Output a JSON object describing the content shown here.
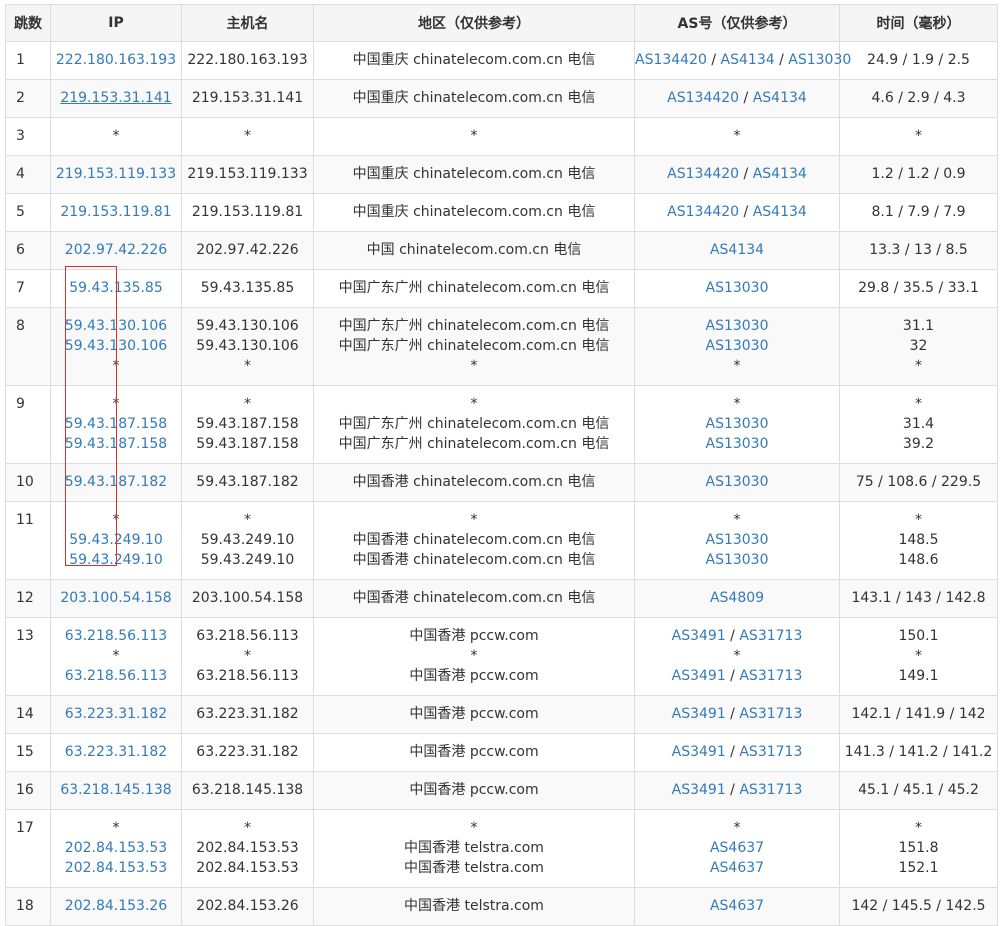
{
  "headers": [
    "跳数",
    "IP",
    "主机名",
    "地区（仅供参考）",
    "AS号（仅供参考）",
    "时间（毫秒）"
  ],
  "rows": [
    {
      "hop": "1",
      "lines": [
        {
          "ip": "222.180.163.193",
          "host": "222.180.163.193",
          "region": "中国重庆 chinatelecom.com.cn 电信",
          "as": [
            "AS134420",
            "AS4134",
            "AS13030"
          ],
          "time": "24.9 / 1.9 / 2.5"
        }
      ]
    },
    {
      "hop": "2",
      "lines": [
        {
          "ip": "219.153.31.141",
          "underline": true,
          "host": "219.153.31.141",
          "region": "中国重庆 chinatelecom.com.cn 电信",
          "as": [
            "AS134420",
            "AS4134"
          ],
          "time": "4.6 / 2.9 / 4.3"
        }
      ]
    },
    {
      "hop": "3",
      "lines": [
        {
          "ip": "*",
          "host": "*",
          "region": "*",
          "as": [],
          "as_text": "*",
          "time": "*"
        }
      ]
    },
    {
      "hop": "4",
      "lines": [
        {
          "ip": "219.153.119.133",
          "host": "219.153.119.133",
          "region": "中国重庆 chinatelecom.com.cn 电信",
          "as": [
            "AS134420",
            "AS4134"
          ],
          "time": "1.2 / 1.2 / 0.9"
        }
      ]
    },
    {
      "hop": "5",
      "lines": [
        {
          "ip": "219.153.119.81",
          "host": "219.153.119.81",
          "region": "中国重庆 chinatelecom.com.cn 电信",
          "as": [
            "AS134420",
            "AS4134"
          ],
          "time": "8.1 / 7.9 / 7.9"
        }
      ]
    },
    {
      "hop": "6",
      "lines": [
        {
          "ip": "202.97.42.226",
          "host": "202.97.42.226",
          "region": "中国 chinatelecom.com.cn 电信",
          "as": [
            "AS4134"
          ],
          "time": "13.3 / 13 / 8.5"
        }
      ]
    },
    {
      "hop": "7",
      "lines": [
        {
          "ip": "59.43.135.85",
          "host": "59.43.135.85",
          "region": "中国广东广州 chinatelecom.com.cn 电信",
          "as": [
            "AS13030"
          ],
          "time": "29.8 / 35.5 / 33.1"
        }
      ]
    },
    {
      "hop": "8",
      "lines": [
        {
          "ip": "59.43.130.106",
          "host": "59.43.130.106",
          "region": "中国广东广州 chinatelecom.com.cn 电信",
          "as": [
            "AS13030"
          ],
          "time": "31.1"
        },
        {
          "ip": "59.43.130.106",
          "host": "59.43.130.106",
          "region": "中国广东广州 chinatelecom.com.cn 电信",
          "as": [
            "AS13030"
          ],
          "time": "32"
        },
        {
          "ip": "*",
          "host": "*",
          "region": "*",
          "as": [],
          "as_text": "*",
          "time": "*"
        }
      ]
    },
    {
      "hop": "9",
      "lines": [
        {
          "ip": "*",
          "host": "*",
          "region": "*",
          "as": [],
          "as_text": "*",
          "time": "*"
        },
        {
          "ip": "59.43.187.158",
          "host": "59.43.187.158",
          "region": "中国广东广州 chinatelecom.com.cn 电信",
          "as": [
            "AS13030"
          ],
          "time": "31.4"
        },
        {
          "ip": "59.43.187.158",
          "host": "59.43.187.158",
          "region": "中国广东广州 chinatelecom.com.cn 电信",
          "as": [
            "AS13030"
          ],
          "time": "39.2"
        }
      ]
    },
    {
      "hop": "10",
      "lines": [
        {
          "ip": "59.43.187.182",
          "host": "59.43.187.182",
          "region": "中国香港 chinatelecom.com.cn 电信",
          "as": [
            "AS13030"
          ],
          "time": "75 / 108.6 / 229.5"
        }
      ]
    },
    {
      "hop": "11",
      "lines": [
        {
          "ip": "*",
          "host": "*",
          "region": "*",
          "as": [],
          "as_text": "*",
          "time": "*"
        },
        {
          "ip": "59.43.249.10",
          "host": "59.43.249.10",
          "region": "中国香港 chinatelecom.com.cn 电信",
          "as": [
            "AS13030"
          ],
          "time": "148.5"
        },
        {
          "ip": "59.43.249.10",
          "host": "59.43.249.10",
          "region": "中国香港 chinatelecom.com.cn 电信",
          "as": [
            "AS13030"
          ],
          "time": "148.6"
        }
      ]
    },
    {
      "hop": "12",
      "lines": [
        {
          "ip": "203.100.54.158",
          "host": "203.100.54.158",
          "region": "中国香港 chinatelecom.com.cn 电信",
          "as": [
            "AS4809"
          ],
          "time": "143.1 / 143 / 142.8"
        }
      ]
    },
    {
      "hop": "13",
      "lines": [
        {
          "ip": "63.218.56.113",
          "host": "63.218.56.113",
          "region": "中国香港 pccw.com",
          "as": [
            "AS3491",
            "AS31713"
          ],
          "time": "150.1"
        },
        {
          "ip": "*",
          "host": "*",
          "region": "*",
          "as": [],
          "as_text": "*",
          "time": "*"
        },
        {
          "ip": "63.218.56.113",
          "host": "63.218.56.113",
          "region": "中国香港 pccw.com",
          "as": [
            "AS3491",
            "AS31713"
          ],
          "time": "149.1"
        }
      ]
    },
    {
      "hop": "14",
      "lines": [
        {
          "ip": "63.223.31.182",
          "host": "63.223.31.182",
          "region": "中国香港 pccw.com",
          "as": [
            "AS3491",
            "AS31713"
          ],
          "time": "142.1 / 141.9 / 142"
        }
      ]
    },
    {
      "hop": "15",
      "lines": [
        {
          "ip": "63.223.31.182",
          "host": "63.223.31.182",
          "region": "中国香港 pccw.com",
          "as": [
            "AS3491",
            "AS31713"
          ],
          "time": "141.3 / 141.2 / 141.2"
        }
      ]
    },
    {
      "hop": "16",
      "lines": [
        {
          "ip": "63.218.145.138",
          "host": "63.218.145.138",
          "region": "中国香港 pccw.com",
          "as": [
            "AS3491",
            "AS31713"
          ],
          "time": "45.1 / 45.1 / 45.2"
        }
      ]
    },
    {
      "hop": "17",
      "lines": [
        {
          "ip": "*",
          "host": "*",
          "region": "*",
          "as": [],
          "as_text": "*",
          "time": "*"
        },
        {
          "ip": "202.84.153.53",
          "host": "202.84.153.53",
          "region": "中国香港 telstra.com",
          "as": [
            "AS4637"
          ],
          "time": "151.8"
        },
        {
          "ip": "202.84.153.53",
          "host": "202.84.153.53",
          "region": "中国香港 telstra.com",
          "as": [
            "AS4637"
          ],
          "time": "152.1"
        }
      ]
    },
    {
      "hop": "18",
      "lines": [
        {
          "ip": "202.84.153.26",
          "host": "202.84.153.26",
          "region": "中国香港 telstra.com",
          "as": [
            "AS4637"
          ],
          "time": "142 / 145.5 / 142.5"
        }
      ]
    }
  ],
  "colors": {
    "link": "#337ab7",
    "border": "#dddddd",
    "header_bg": "#f5f5f5",
    "stripe": "#f9f9f9",
    "highlight_box": "#d9302c"
  }
}
